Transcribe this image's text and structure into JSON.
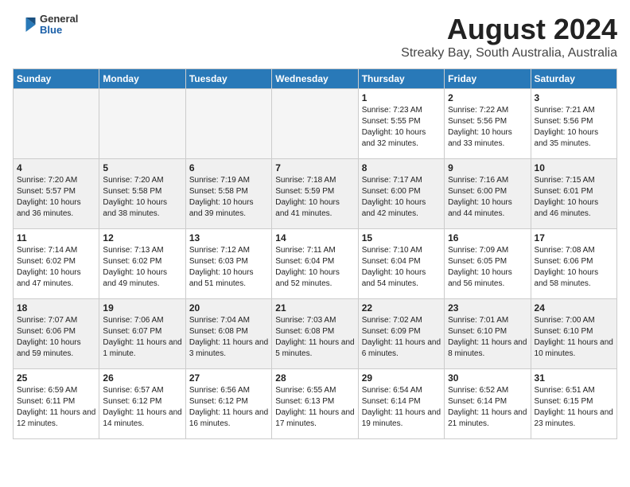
{
  "header": {
    "logo": {
      "general": "General",
      "blue": "Blue"
    },
    "title": "August 2024",
    "location": "Streaky Bay, South Australia, Australia"
  },
  "days_of_week": [
    "Sunday",
    "Monday",
    "Tuesday",
    "Wednesday",
    "Thursday",
    "Friday",
    "Saturday"
  ],
  "weeks": [
    [
      {
        "day": "",
        "empty": true
      },
      {
        "day": "",
        "empty": true
      },
      {
        "day": "",
        "empty": true
      },
      {
        "day": "",
        "empty": true
      },
      {
        "day": "1",
        "sunrise": "7:23 AM",
        "sunset": "5:55 PM",
        "daylight": "10 hours and 32 minutes."
      },
      {
        "day": "2",
        "sunrise": "7:22 AM",
        "sunset": "5:56 PM",
        "daylight": "10 hours and 33 minutes."
      },
      {
        "day": "3",
        "sunrise": "7:21 AM",
        "sunset": "5:56 PM",
        "daylight": "10 hours and 35 minutes."
      }
    ],
    [
      {
        "day": "4",
        "sunrise": "7:20 AM",
        "sunset": "5:57 PM",
        "daylight": "10 hours and 36 minutes."
      },
      {
        "day": "5",
        "sunrise": "7:20 AM",
        "sunset": "5:58 PM",
        "daylight": "10 hours and 38 minutes."
      },
      {
        "day": "6",
        "sunrise": "7:19 AM",
        "sunset": "5:58 PM",
        "daylight": "10 hours and 39 minutes."
      },
      {
        "day": "7",
        "sunrise": "7:18 AM",
        "sunset": "5:59 PM",
        "daylight": "10 hours and 41 minutes."
      },
      {
        "day": "8",
        "sunrise": "7:17 AM",
        "sunset": "6:00 PM",
        "daylight": "10 hours and 42 minutes."
      },
      {
        "day": "9",
        "sunrise": "7:16 AM",
        "sunset": "6:00 PM",
        "daylight": "10 hours and 44 minutes."
      },
      {
        "day": "10",
        "sunrise": "7:15 AM",
        "sunset": "6:01 PM",
        "daylight": "10 hours and 46 minutes."
      }
    ],
    [
      {
        "day": "11",
        "sunrise": "7:14 AM",
        "sunset": "6:02 PM",
        "daylight": "10 hours and 47 minutes."
      },
      {
        "day": "12",
        "sunrise": "7:13 AM",
        "sunset": "6:02 PM",
        "daylight": "10 hours and 49 minutes."
      },
      {
        "day": "13",
        "sunrise": "7:12 AM",
        "sunset": "6:03 PM",
        "daylight": "10 hours and 51 minutes."
      },
      {
        "day": "14",
        "sunrise": "7:11 AM",
        "sunset": "6:04 PM",
        "daylight": "10 hours and 52 minutes."
      },
      {
        "day": "15",
        "sunrise": "7:10 AM",
        "sunset": "6:04 PM",
        "daylight": "10 hours and 54 minutes."
      },
      {
        "day": "16",
        "sunrise": "7:09 AM",
        "sunset": "6:05 PM",
        "daylight": "10 hours and 56 minutes."
      },
      {
        "day": "17",
        "sunrise": "7:08 AM",
        "sunset": "6:06 PM",
        "daylight": "10 hours and 58 minutes."
      }
    ],
    [
      {
        "day": "18",
        "sunrise": "7:07 AM",
        "sunset": "6:06 PM",
        "daylight": "10 hours and 59 minutes."
      },
      {
        "day": "19",
        "sunrise": "7:06 AM",
        "sunset": "6:07 PM",
        "daylight": "11 hours and 1 minute."
      },
      {
        "day": "20",
        "sunrise": "7:04 AM",
        "sunset": "6:08 PM",
        "daylight": "11 hours and 3 minutes."
      },
      {
        "day": "21",
        "sunrise": "7:03 AM",
        "sunset": "6:08 PM",
        "daylight": "11 hours and 5 minutes."
      },
      {
        "day": "22",
        "sunrise": "7:02 AM",
        "sunset": "6:09 PM",
        "daylight": "11 hours and 6 minutes."
      },
      {
        "day": "23",
        "sunrise": "7:01 AM",
        "sunset": "6:10 PM",
        "daylight": "11 hours and 8 minutes."
      },
      {
        "day": "24",
        "sunrise": "7:00 AM",
        "sunset": "6:10 PM",
        "daylight": "11 hours and 10 minutes."
      }
    ],
    [
      {
        "day": "25",
        "sunrise": "6:59 AM",
        "sunset": "6:11 PM",
        "daylight": "11 hours and 12 minutes."
      },
      {
        "day": "26",
        "sunrise": "6:57 AM",
        "sunset": "6:12 PM",
        "daylight": "11 hours and 14 minutes."
      },
      {
        "day": "27",
        "sunrise": "6:56 AM",
        "sunset": "6:12 PM",
        "daylight": "11 hours and 16 minutes."
      },
      {
        "day": "28",
        "sunrise": "6:55 AM",
        "sunset": "6:13 PM",
        "daylight": "11 hours and 17 minutes."
      },
      {
        "day": "29",
        "sunrise": "6:54 AM",
        "sunset": "6:14 PM",
        "daylight": "11 hours and 19 minutes."
      },
      {
        "day": "30",
        "sunrise": "6:52 AM",
        "sunset": "6:14 PM",
        "daylight": "11 hours and 21 minutes."
      },
      {
        "day": "31",
        "sunrise": "6:51 AM",
        "sunset": "6:15 PM",
        "daylight": "11 hours and 23 minutes."
      }
    ]
  ]
}
